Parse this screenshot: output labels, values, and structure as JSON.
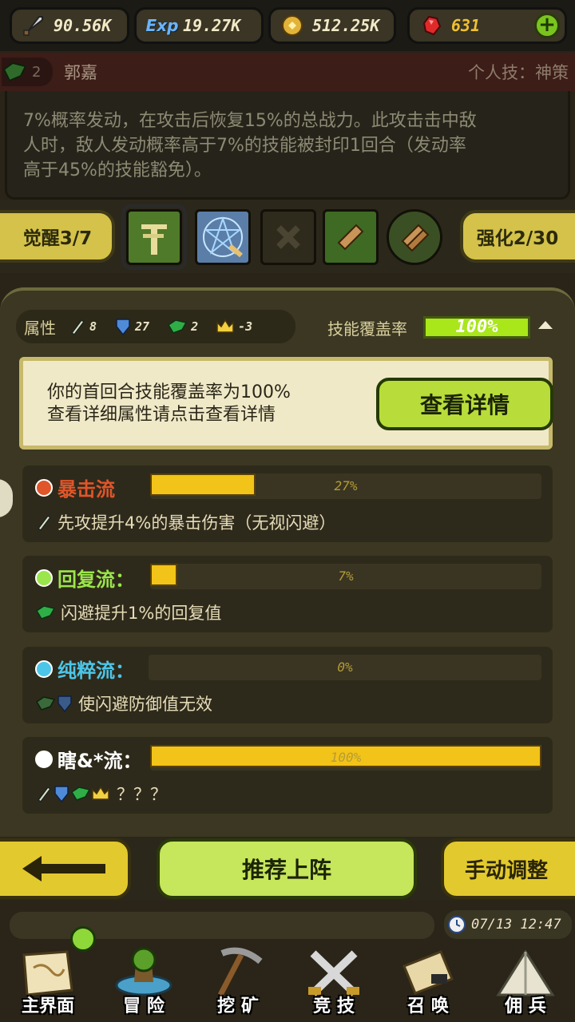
{
  "resources": {
    "attack": "90.56K",
    "exp_icon_text": "Exp",
    "exp": "19.27K",
    "gold": "512.25K",
    "gems": "631"
  },
  "skill": {
    "gem_count": "2",
    "hero_name": "郭嘉",
    "type_label": "个人技：神策",
    "description_line1": "7%概率发动，在攻击后恢复15%的总战力。此攻击击中敌",
    "description_line2": "人时，敌人发动概率高于7%的技能被封印1回合（发动率",
    "description_line3": "高于45%的技能豁免）。"
  },
  "awaken": {
    "awaken_label": "觉醒3/7",
    "enhance_label": "强化2/30"
  },
  "attributes": {
    "label": "属性",
    "sword": "8",
    "shield": "27",
    "dodge": "2",
    "crown": "-3"
  },
  "coverage": {
    "label": "技能覆盖率",
    "value": "100%"
  },
  "info": {
    "line1": "你的首回合技能覆盖率为100%",
    "line2": "查看详细属性请点击查看详情",
    "button": "查看详情"
  },
  "flows": [
    {
      "name": "暴击流",
      "pct_label": "27%",
      "pct": 27,
      "effect": "先攻提升4%的暴击伤害（无视闪避）",
      "color": "#e0552a"
    },
    {
      "name": "回复流：",
      "pct_label": "7%",
      "pct": 7,
      "effect": "闪避提升1%的回复值",
      "color": "#9be64a"
    },
    {
      "name": "纯粹流：",
      "pct_label": "0%",
      "pct": 0,
      "effect": "使闪避防御值无效",
      "color": "#4cc6e8"
    },
    {
      "name": "瞎&*流：",
      "pct_label": "100%",
      "pct": 100,
      "effect": "？？？",
      "color": "#ffffff"
    }
  ],
  "buttons": {
    "recommend": "推荐上阵",
    "manual": "手动调整"
  },
  "clock": "07/13 12:47",
  "nav": {
    "home": "主界面",
    "adventure": "冒 险",
    "mine": "挖 矿",
    "arena": "竞 技",
    "summon": "召 唤",
    "mercenary": "佣 兵"
  }
}
